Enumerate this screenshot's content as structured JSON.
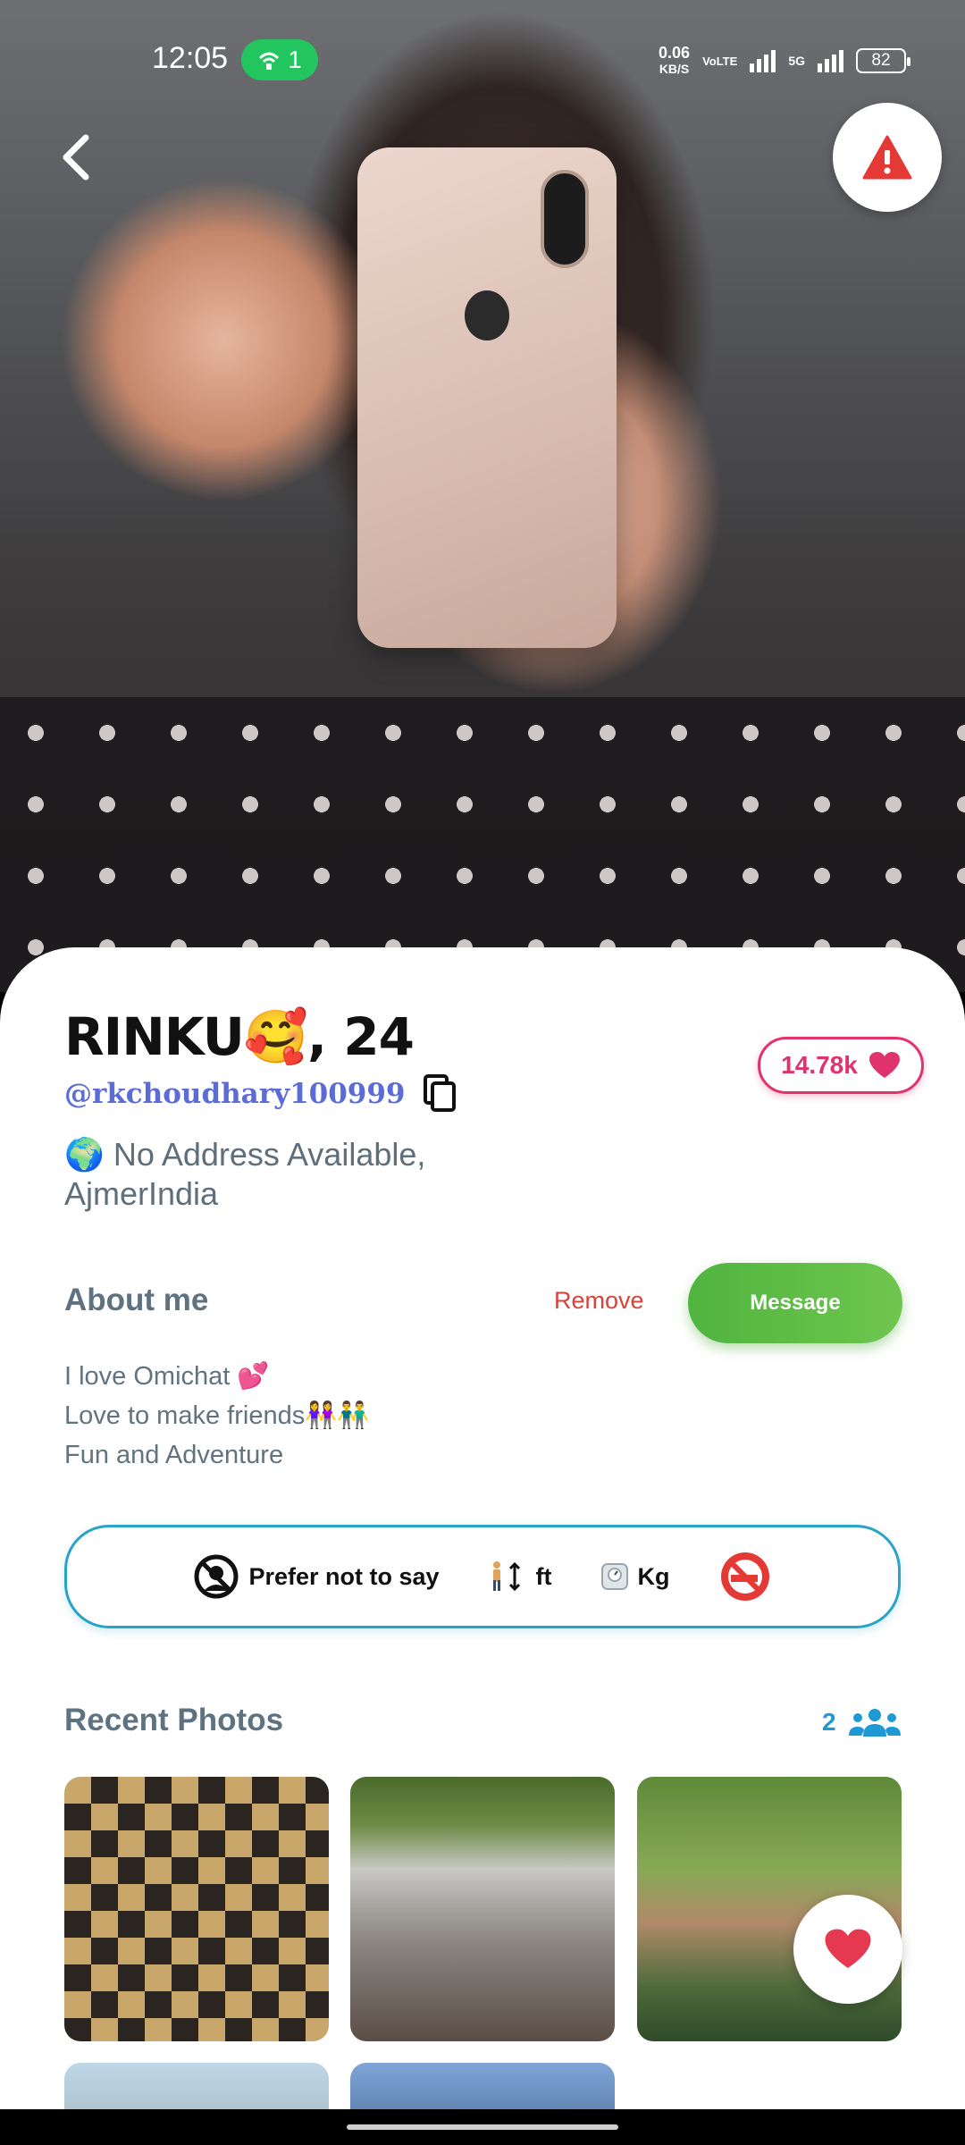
{
  "status_bar": {
    "time": "12:05",
    "hotspot_count": "1",
    "net_speed_value": "0.06",
    "net_speed_unit": "KB/S",
    "volte_label": "VoLTE",
    "network": "5G",
    "battery": "82"
  },
  "profile": {
    "name": "RINKU🥰, 24",
    "handle": "@rkchoudhary100999",
    "likes": "14.78k",
    "address_line1": "🌍 No Address Available,",
    "address_line2": "AjmerIndia"
  },
  "about": {
    "title": "About me",
    "remove_label": "Remove",
    "message_label": "Message",
    "bio_lines": [
      "I love Omichat 💕",
      "Love to make friends👭👬",
      "Fun and Adventure"
    ]
  },
  "traits": {
    "religion": "Prefer not to say",
    "height": "ft",
    "weight": "Kg"
  },
  "photos": {
    "title": "Recent Photos",
    "count": "2"
  },
  "colors": {
    "accent_pink": "#e0336e",
    "accent_green": "#4fb43f",
    "accent_blue": "#1d9ad6",
    "alert_red": "#e53935"
  }
}
